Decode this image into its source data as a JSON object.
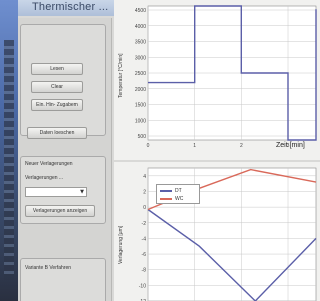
{
  "window": {
    "title": "Thermischer ..."
  },
  "panel": {
    "btn1": "Lesen",
    "btn2": "Clear",
    "btn3": "Ein. Hin- Zugabem",
    "btn4": "Daten loeschen",
    "group2_title": "Neuer Verlagerungen",
    "group2_label": "Verlagerungen ...",
    "select_value": "",
    "btn5": "Verlagerungen anzeigen",
    "group3_title": "Variante B Verfahren"
  },
  "chart_top": {
    "ylabel": "Temperatur [°C/min]",
    "xlabel": "Zeit [min]",
    "yticks": [
      "4500",
      "4000",
      "3500",
      "3000",
      "2500",
      "2000",
      "1500",
      "1000",
      "500"
    ],
    "xticks": [
      "0",
      "1",
      "2",
      "3"
    ]
  },
  "chart_bottom": {
    "ylabel": "Verlagerung [µm]",
    "yticks": [
      "4",
      "2",
      "0",
      "-2",
      "-4",
      "-6",
      "-8",
      "-10",
      "-12"
    ],
    "legend": [
      {
        "name": "DT",
        "color": "#5b5fa8"
      },
      {
        "name": "WC",
        "color": "#d9695a"
      }
    ]
  },
  "chart_data": [
    {
      "type": "line",
      "title": "",
      "xlabel": "Zeit [min]",
      "ylabel": "Temperatur [°C/min]",
      "series": [
        {
          "values": [
            [
              0,
              2300
            ],
            [
              1,
              2300
            ],
            [
              1,
              4700
            ],
            [
              2,
              4700
            ],
            [
              2,
              2600
            ],
            [
              3,
              2600
            ],
            [
              3,
              500
            ],
            [
              3.6,
              500
            ],
            [
              3.6,
              4600
            ]
          ]
        }
      ],
      "ylim": [
        500,
        4700
      ],
      "xlim": [
        0,
        3.6
      ]
    },
    {
      "type": "line",
      "title": "",
      "xlabel": "",
      "ylabel": "Verlagerung [µm]",
      "series": [
        {
          "name": "DT",
          "values": [
            [
              0,
              -0.3
            ],
            [
              1.1,
              -5
            ],
            [
              2.3,
              -12
            ],
            [
              3.6,
              -4
            ]
          ]
        },
        {
          "name": "WC",
          "values": [
            [
              0,
              -0.3
            ],
            [
              1.1,
              2.4
            ],
            [
              2.2,
              4.8
            ],
            [
              3.6,
              3.2
            ]
          ]
        }
      ],
      "ylim": [
        -12,
        5
      ]
    }
  ]
}
